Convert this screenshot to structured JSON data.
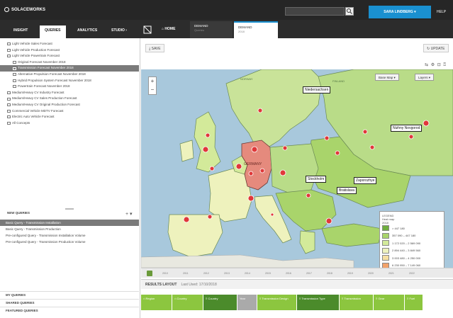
{
  "app": {
    "name": "SOLACEWORKS",
    "search_placeholder": "",
    "user_button": "SARA LINDBERG ▾",
    "help": "HELP"
  },
  "left_tabs": [
    "INSIGHT",
    "QUERIES",
    "ANALYTICS",
    "STUDIO ›"
  ],
  "home_tab": "HOME",
  "doc_tabs": [
    {
      "title": "DEMAND",
      "subtitle": "Queries"
    },
    {
      "title": "DEMAND",
      "subtitle": "2018"
    }
  ],
  "tree": [
    "Light Vehicle Sales Forecast",
    "Light Vehicle Production Forecast",
    "Light Vehicle Powertrain Forecast",
    "Original Forecast November 2018",
    "Transmission Forecast November 2018",
    "Alternative Propulsion Forecast November 2018",
    "Hybrid Propulsion System Forecast November 2018",
    "Powertrain Forecast November 2018",
    "Medium/Heavy CV Industry Forecast",
    "Medium/Heavy CV Sales Production Forecast",
    "Medium/Heavy CV Original Production Forecast",
    "Commercial Vehicle MDTV Forecast",
    "Electric Auto Vehicle Forecast",
    "All Concepts"
  ],
  "tree_selected_index": 4,
  "new_queries": {
    "title": "NEW QUERIES",
    "items": [
      "Basic Query - Transmission Installation",
      "Basic Query - Transmission Production",
      "Pre-configured Query - Transmission Installation Volume",
      "Pre-configured Query - Transmission Production Volume"
    ],
    "selected_index": 0
  },
  "bottom_sections": [
    "MY QUERIES",
    "SHARED QUERIES",
    "FEATURED QUERIES"
  ],
  "toolbar": {
    "save": "SAVE",
    "update": "UPDATE",
    "tool_icons": "⇆ ⚙ ⊡ ⍰"
  },
  "map": {
    "zoom_in": "+",
    "zoom_out": "−",
    "basemap_dd": "Base Map ▾",
    "layers_dd": "Layers ▾",
    "labels": [
      "Niedersachsen",
      "Nizhny Novgorod",
      "Stockholm",
      "Zaporozhye",
      "Bratislava"
    ],
    "regions": [
      "NORWAY",
      "FINLAND",
      "GERMANY"
    ],
    "legend": {
      "title": "LEGEND",
      "subtitle": "Heat map",
      "note": "2018",
      "rows": [
        {
          "label": "> 447 180",
          "color": "#6fae3e"
        },
        {
          "label": "357 090 – 447 180",
          "color": "#a9d46b"
        },
        {
          "label": "1 172 020 – 2 569 090",
          "color": "#d3ea9a"
        },
        {
          "label": "2 894 440 – 3 849 560",
          "color": "#eef2bd"
        },
        {
          "label": "3 003 480 – 4 250 000",
          "color": "#f6dfa2"
        },
        {
          "label": "6 230 950 – 7 149 060",
          "color": "#f2a26a"
        },
        {
          "label": "> 6 149 000",
          "color": "#e05a4e"
        }
      ]
    }
  },
  "timeline": [
    "2010",
    "2011",
    "2012",
    "2013",
    "2014",
    "2015",
    "2016",
    "2017",
    "2018",
    "2019",
    "2020",
    "2021",
    "2022"
  ],
  "results": {
    "title": "RESULTS LAYOUT",
    "subtitle": "Last Used: 17/10/2018",
    "chips": [
      {
        "label": "⌂ Region",
        "kind": "normal"
      },
      {
        "label": "⌂ Country",
        "kind": "normal"
      },
      {
        "label": "≡ Country",
        "kind": "dark"
      },
      {
        "label": "Year",
        "kind": "grey"
      },
      {
        "label": "≡ Transmission Design",
        "kind": "normal"
      },
      {
        "label": "≡ Transmission Type",
        "kind": "dark"
      },
      {
        "label": "≡ Transmission",
        "kind": "normal"
      },
      {
        "label": "≡ Gear",
        "kind": "normal"
      },
      {
        "label": "≡ Fuel",
        "kind": "normal"
      }
    ]
  },
  "colors": {
    "accent": "#1a90d0",
    "selection": "#7a7a7a",
    "germany": "#e58a7d",
    "sea": "#a8c8dc"
  }
}
